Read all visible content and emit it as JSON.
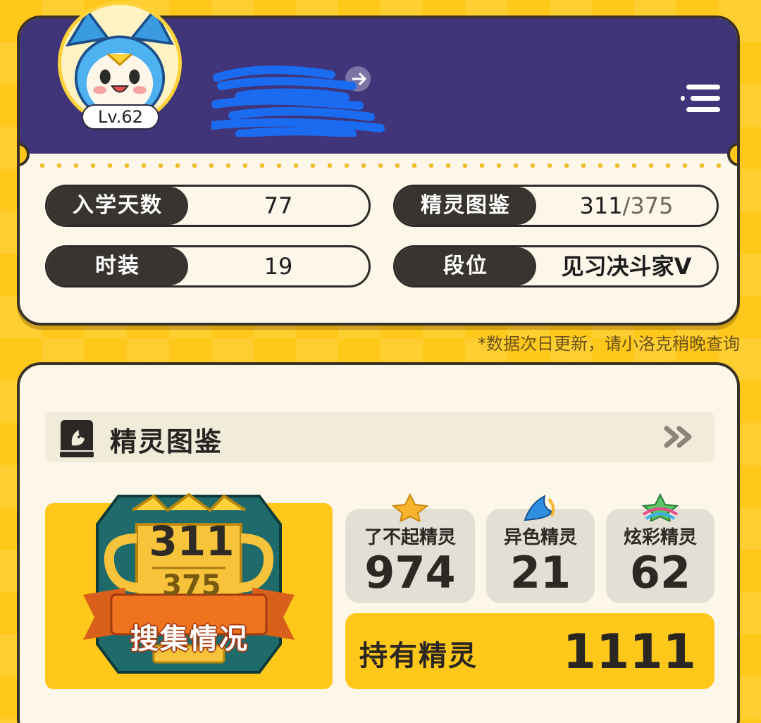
{
  "profile": {
    "level": "Lv.62",
    "stats": [
      {
        "label": "入学天数",
        "value": "77"
      },
      {
        "label": "精灵图鉴",
        "value": "311",
        "denom": "/375"
      },
      {
        "label": "时装",
        "value": "19"
      },
      {
        "label": "段位",
        "value": "见习决斗家V"
      }
    ],
    "update_note": "*数据次日更新，请小洛克稍晚查询"
  },
  "dex": {
    "title": "精灵图鉴",
    "collection": {
      "owned": "311",
      "total": "375",
      "caption": "搜集情况"
    },
    "rare": [
      {
        "label": "了不起精灵",
        "value": "974",
        "icon": "star-icon"
      },
      {
        "label": "异色精灵",
        "value": "21",
        "icon": "blue-flame-icon"
      },
      {
        "label": "炫彩精灵",
        "value": "62",
        "icon": "rainbow-star-icon"
      }
    ],
    "owned_label": "持有精灵",
    "owned_value": "1111"
  },
  "colors": {
    "background": "#ffc81a",
    "header": "#3f3578",
    "card": "#fdf7ea",
    "pill_label": "#38342f"
  }
}
